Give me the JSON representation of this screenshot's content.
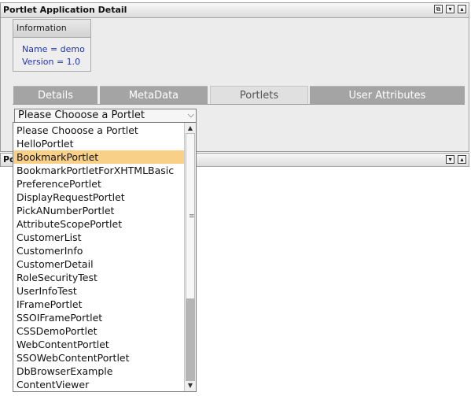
{
  "portlet1": {
    "title": "Portlet Application Detail",
    "buttons": [
      "⧉",
      "▾",
      "▴"
    ]
  },
  "portlet2": {
    "title": "Po",
    "buttons": [
      "▾",
      "▴"
    ]
  },
  "info": {
    "heading": "Information",
    "name": "Name = demo",
    "version": "Version = 1.0"
  },
  "tabs": [
    {
      "label": "Details",
      "active": false
    },
    {
      "label": "MetaData",
      "active": false
    },
    {
      "label": "Portlets",
      "active": true
    },
    {
      "label": "User Attributes",
      "active": false
    }
  ],
  "select": {
    "value": "Please Chooose a Portlet"
  },
  "dropdown": {
    "selected_index": 2,
    "options": [
      "Please Chooose a Portlet",
      "HelloPortlet",
      "BookmarkPortlet",
      "BookmarkPortletForXHTMLBasic",
      "PreferencePortlet",
      "DisplayRequestPortlet",
      "PickANumberPortlet",
      "AttributeScopePortlet",
      "CustomerList",
      "CustomerInfo",
      "CustomerDetail",
      "RoleSecurityTest",
      "UserInfoTest",
      "IFramePortlet",
      "SSOIFramePortlet",
      "CSSDemoPortlet",
      "WebContentPortlet",
      "SSOWebContentPortlet",
      "DbBrowserExample",
      "ContentViewer"
    ]
  },
  "colors": {
    "selected_option": "#f8d088",
    "tab_inactive": "#a4a4a4",
    "tab_active": "#e0e0e0",
    "info_text": "#2134a8"
  }
}
